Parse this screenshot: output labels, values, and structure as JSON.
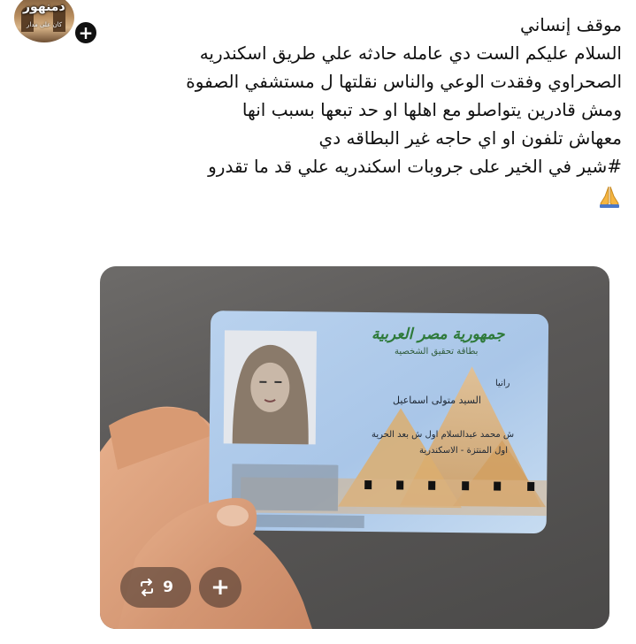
{
  "account": {
    "name": "دمنهور",
    "subtitle": "كان على مدار"
  },
  "follow": {
    "label": "+"
  },
  "post": {
    "lines": [
      "موقف إنساني",
      "السلام عليكم الست دي عامله حادثه علي طريق اسكندريه",
      "الصحراوي وفقدت الوعي والناس نقلتها ل مستشفي الصفوة",
      "ومش قادرين يتواصلو مع اهلها او حد تبعها بسبب انها",
      "معهاش تلفون او اي حاجه غير البطاقه دي",
      "#شير في الخير على جروبات اسكندريه علي قد ما تقدرو"
    ],
    "emoji": "folded-hands-icon"
  },
  "id_card": {
    "title": "جمهورية مصر العربية",
    "subtitle": "بطاقة تحقيق الشخصية",
    "first_name": "رانيا",
    "full_name": "السيد متولى اسماعيل",
    "address_line1": "ش محمد عبدالسلام اول ش بعد الحرية",
    "address_line2": "اول المنتزة - الاسكندرية"
  },
  "actions": {
    "repost_count": "9",
    "add_label": "+"
  },
  "colors": {
    "card_blue": "#a9c6e8",
    "pyramid_sand": "#d9a867",
    "title_green": "#2e7a3a"
  }
}
